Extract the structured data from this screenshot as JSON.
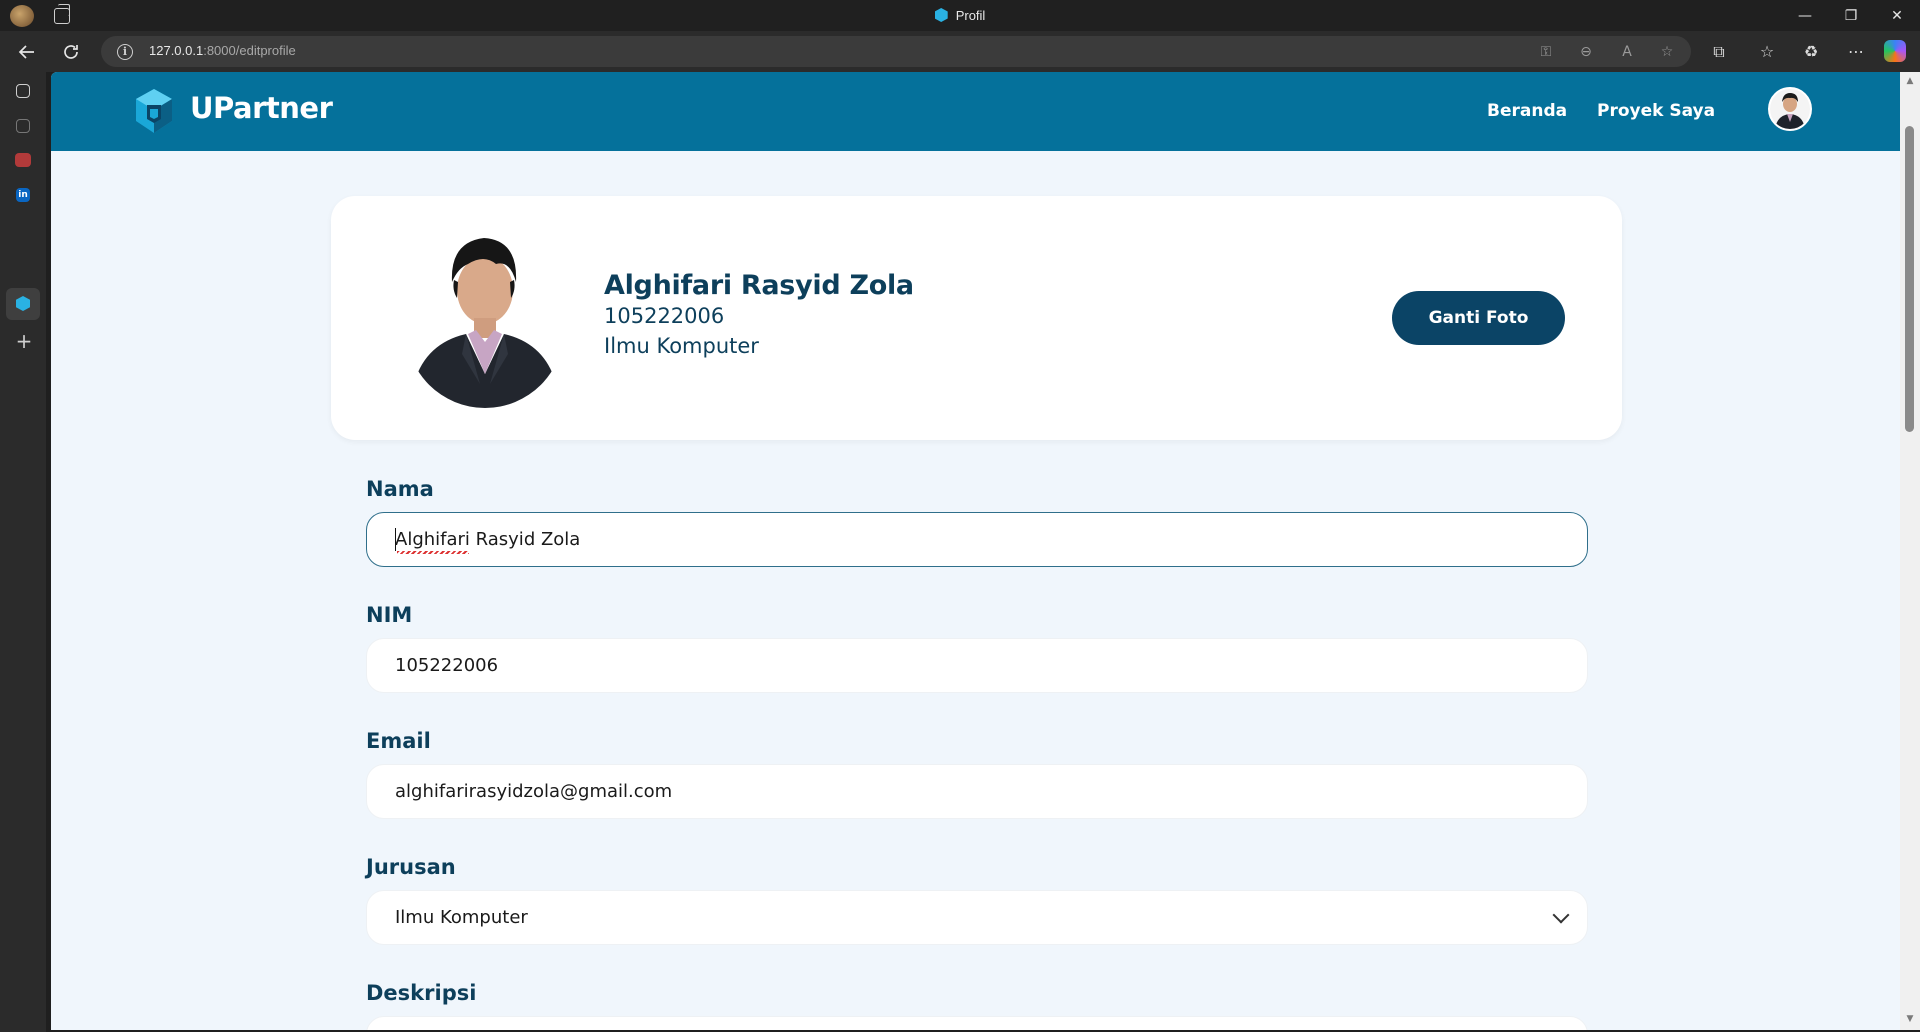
{
  "browser": {
    "tab_title": "Profil",
    "url_host": "127.0.0.1",
    "url_rest": ":8000/editprofile",
    "window_controls": [
      "—",
      "❐",
      "✕"
    ]
  },
  "navbar": {
    "brand": "UPartner",
    "links": [
      "Beranda",
      "Proyek Saya"
    ],
    "color": "#05719b"
  },
  "profile": {
    "name": "Alghifari Rasyid Zola",
    "nim": "105222006",
    "major": "Ilmu Komputer",
    "change_photo_label": "Ganti Foto"
  },
  "form": {
    "name_label": "Nama",
    "name_value": "Alghifari Rasyid Zola",
    "nim_label": "NIM",
    "nim_value": "105222006",
    "email_label": "Email",
    "email_value": "alghifarirasyidzola@gmail.com",
    "major_label": "Jurusan",
    "major_value": "Ilmu Komputer",
    "description_label": "Deskripsi"
  },
  "colors": {
    "primary_dark": "#0b4466",
    "heading": "#0d3f5b",
    "page_bg": "#f0f6fc"
  }
}
